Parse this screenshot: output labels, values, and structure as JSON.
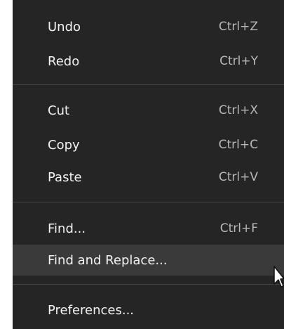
{
  "menu": {
    "items": [
      {
        "label": "Undo",
        "shortcut": "Ctrl+Z"
      },
      {
        "label": "Redo",
        "shortcut": "Ctrl+Y"
      },
      {
        "label": "Cut",
        "shortcut": "Ctrl+X"
      },
      {
        "label": "Copy",
        "shortcut": "Ctrl+C"
      },
      {
        "label": "Paste",
        "shortcut": "Ctrl+V"
      },
      {
        "label": "Find...",
        "shortcut": "Ctrl+F"
      },
      {
        "label": "Find and Replace...",
        "shortcut": ""
      },
      {
        "label": "Preferences...",
        "shortcut": ""
      }
    ],
    "hovered_item": "Find and Replace..."
  },
  "colors": {
    "menu_background": "#252526",
    "hover_background": "#3a3a3b",
    "text": "#f2f2f2",
    "shortcut_text": "#b8b8b8",
    "separator": "#434345"
  },
  "icons": {
    "pointer": "mouse-pointer-icon"
  }
}
